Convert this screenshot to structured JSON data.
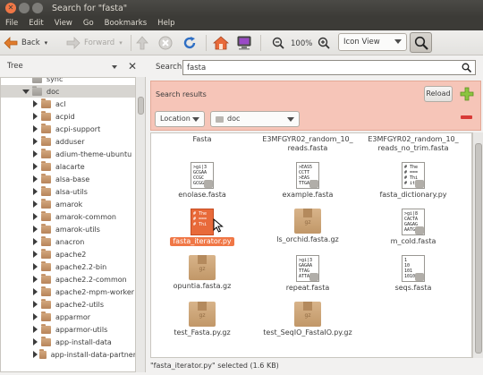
{
  "window": {
    "title": "Search for \"fasta\""
  },
  "menu": [
    "File",
    "Edit",
    "View",
    "Go",
    "Bookmarks",
    "Help"
  ],
  "toolbar": {
    "back": "Back",
    "forward": "Forward",
    "zoom": "100%",
    "view_mode": "Icon View"
  },
  "sidebar": {
    "header": "Tree",
    "items": [
      {
        "label": "sync",
        "level": 0,
        "state": "none",
        "folder": "gray"
      },
      {
        "label": "doc",
        "level": 0,
        "state": "open",
        "folder": "gray"
      },
      {
        "label": "acl",
        "level": 1,
        "state": "closed",
        "folder": "brown"
      },
      {
        "label": "acpid",
        "level": 1,
        "state": "closed",
        "folder": "brown"
      },
      {
        "label": "acpi-support",
        "level": 1,
        "state": "closed",
        "folder": "brown"
      },
      {
        "label": "adduser",
        "level": 1,
        "state": "closed",
        "folder": "brown"
      },
      {
        "label": "adium-theme-ubuntu",
        "level": 1,
        "state": "closed",
        "folder": "brown"
      },
      {
        "label": "alacarte",
        "level": 1,
        "state": "closed",
        "folder": "brown"
      },
      {
        "label": "alsa-base",
        "level": 1,
        "state": "closed",
        "folder": "brown"
      },
      {
        "label": "alsa-utils",
        "level": 1,
        "state": "closed",
        "folder": "brown"
      },
      {
        "label": "amarok",
        "level": 1,
        "state": "closed",
        "folder": "brown"
      },
      {
        "label": "amarok-common",
        "level": 1,
        "state": "closed",
        "folder": "brown"
      },
      {
        "label": "amarok-utils",
        "level": 1,
        "state": "closed",
        "folder": "brown"
      },
      {
        "label": "anacron",
        "level": 1,
        "state": "closed",
        "folder": "brown"
      },
      {
        "label": "apache2",
        "level": 1,
        "state": "closed",
        "folder": "brown"
      },
      {
        "label": "apache2.2-bin",
        "level": 1,
        "state": "closed",
        "folder": "brown"
      },
      {
        "label": "apache2.2-common",
        "level": 1,
        "state": "closed",
        "folder": "brown"
      },
      {
        "label": "apache2-mpm-worker",
        "level": 1,
        "state": "closed",
        "folder": "brown"
      },
      {
        "label": "apache2-utils",
        "level": 1,
        "state": "closed",
        "folder": "brown"
      },
      {
        "label": "apparmor",
        "level": 1,
        "state": "closed",
        "folder": "brown"
      },
      {
        "label": "apparmor-utils",
        "level": 1,
        "state": "closed",
        "folder": "brown"
      },
      {
        "label": "app-install-data",
        "level": 1,
        "state": "closed",
        "folder": "brown"
      },
      {
        "label": "app-install-data-partner",
        "level": 1,
        "state": "closed",
        "folder": "brown"
      }
    ]
  },
  "search": {
    "label": "Search:",
    "value": "fasta"
  },
  "results": {
    "title": "Search results",
    "reload": "Reload",
    "criterion": "Location",
    "location": "doc"
  },
  "files": [
    {
      "name": "Fasta",
      "name2": "",
      "icon": "none"
    },
    {
      "name": "E3MFGYR02_random_10_",
      "name2": "reads.fasta",
      "icon": "none"
    },
    {
      "name": "E3MFGYR02_random_10_",
      "name2": "reads_no_trim.fasta",
      "icon": "none"
    },
    {
      "name": "enolase.fasta",
      "name2": "",
      "icon": "text",
      "preview": ">gi|3\nGCGAA\nCCGC\nGCGG"
    },
    {
      "name": "example.fasta",
      "name2": "",
      "icon": "text",
      "preview": ">EAS5\nCCTT\n>EAS\nTTGA"
    },
    {
      "name": "fasta_dictionary.py",
      "name2": "",
      "icon": "text",
      "preview": "# The\n# ===\n# Thi\n# it"
    },
    {
      "name": "fasta_iterator.py",
      "name2": "",
      "icon": "script-selected",
      "preview": "# The\n# ===\n# Thi"
    },
    {
      "name": "ls_orchid.fasta.gz",
      "name2": "",
      "icon": "archive"
    },
    {
      "name": "m_cold.fasta",
      "name2": "",
      "icon": "text",
      "preview": ">gi|8\nCACTA\nGAGAG\nAATGA"
    },
    {
      "name": "opuntia.fasta.gz",
      "name2": "",
      "icon": "archive"
    },
    {
      "name": "repeat.fasta",
      "name2": "",
      "icon": "text",
      "preview": ">gi|3\nGAGAA\nTTAG\nATTAA"
    },
    {
      "name": "seqs.fasta",
      "name2": "",
      "icon": "binary",
      "preview": "1\n10\n101\n1010"
    },
    {
      "name": "test_Fasta.py.gz",
      "name2": "",
      "icon": "archive"
    },
    {
      "name": "test_SeqIO_FastaIO.py.gz",
      "name2": "",
      "icon": "archive"
    }
  ],
  "status": "\"fasta_iterator.py\" selected (1.6 KB)",
  "colors": {
    "accent": "#f07746",
    "results_bg": "#f6c5b8",
    "menubar": "#3c3b37"
  }
}
